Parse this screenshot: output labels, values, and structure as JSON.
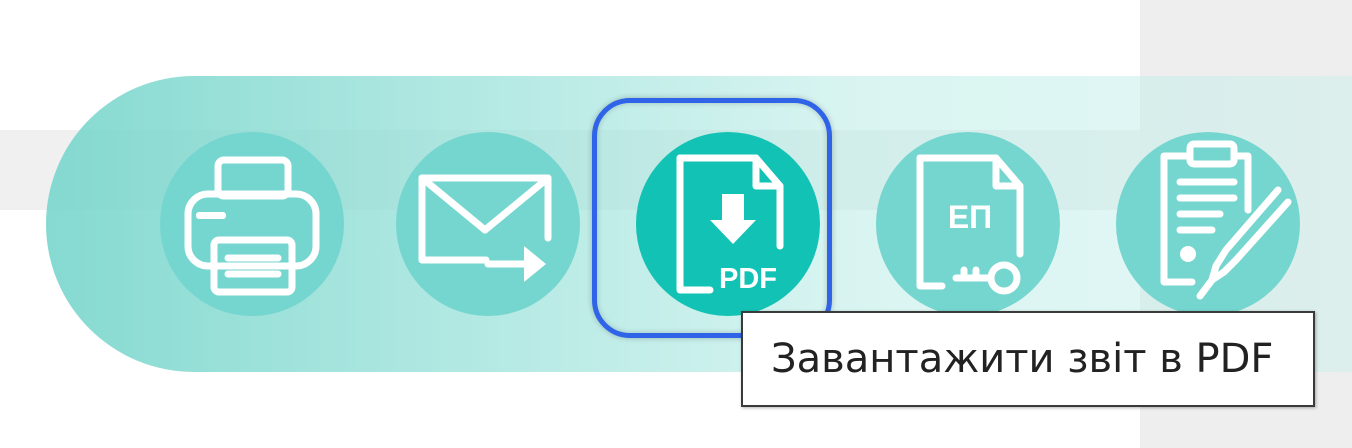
{
  "toolbar": {
    "buttons": [
      {
        "id": "print",
        "icon": "printer-icon"
      },
      {
        "id": "email",
        "icon": "envelope-send-icon"
      },
      {
        "id": "download-pdf",
        "icon": "file-download-pdf-icon",
        "label": "PDF",
        "active": true
      },
      {
        "id": "e-signature",
        "icon": "file-key-icon",
        "label": "ЕП"
      },
      {
        "id": "sign",
        "icon": "clipboard-pen-icon"
      }
    ]
  },
  "tooltip": {
    "text": "Завантажити звіт в PDF"
  },
  "colors": {
    "button_bg": "#75d6cf",
    "button_active_bg": "#12c2b4",
    "focus_ring": "#2f63e8",
    "icon_stroke": "#ffffff"
  }
}
